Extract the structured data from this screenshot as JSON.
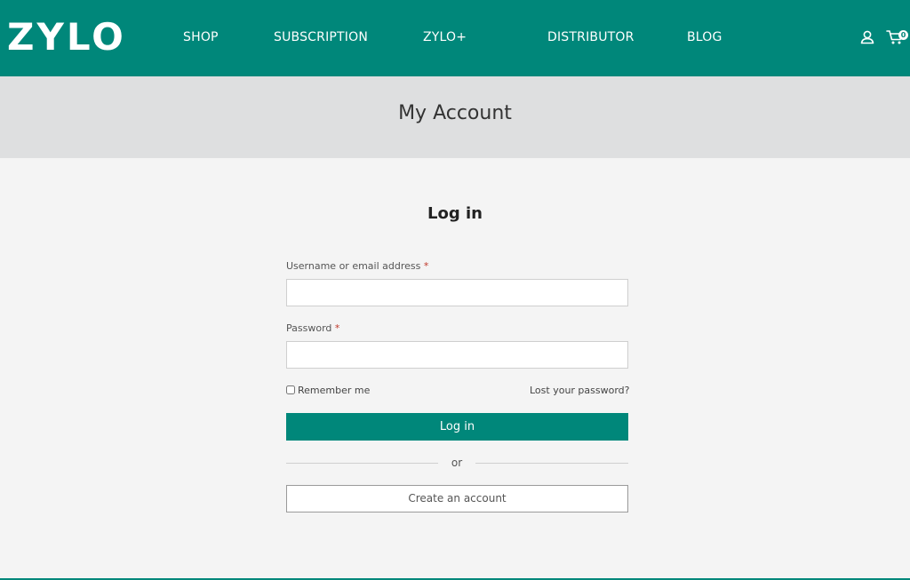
{
  "brand": {
    "logo_text": "ZYLO",
    "primary_color": "#00877a"
  },
  "nav": {
    "items": [
      {
        "label": "SHOP"
      },
      {
        "label": "SUBSCRIPTION"
      },
      {
        "label": "ZYLO+"
      },
      {
        "label": "DISTRIBUTOR"
      },
      {
        "label": "BLOG"
      }
    ],
    "account_icon": "user-icon",
    "cart_icon": "cart-icon",
    "cart_count": "0"
  },
  "hero": {
    "title": "My Account"
  },
  "login": {
    "heading": "Log in",
    "username_label": "Username or email address",
    "password_label": "Password",
    "required_mark": "*",
    "username_value": "",
    "password_value": "",
    "remember_label": "Remember me",
    "remember_checked": false,
    "lost_password": "Lost your password?",
    "submit_label": "Log in",
    "separator": "or",
    "create_account": "Create an account"
  }
}
